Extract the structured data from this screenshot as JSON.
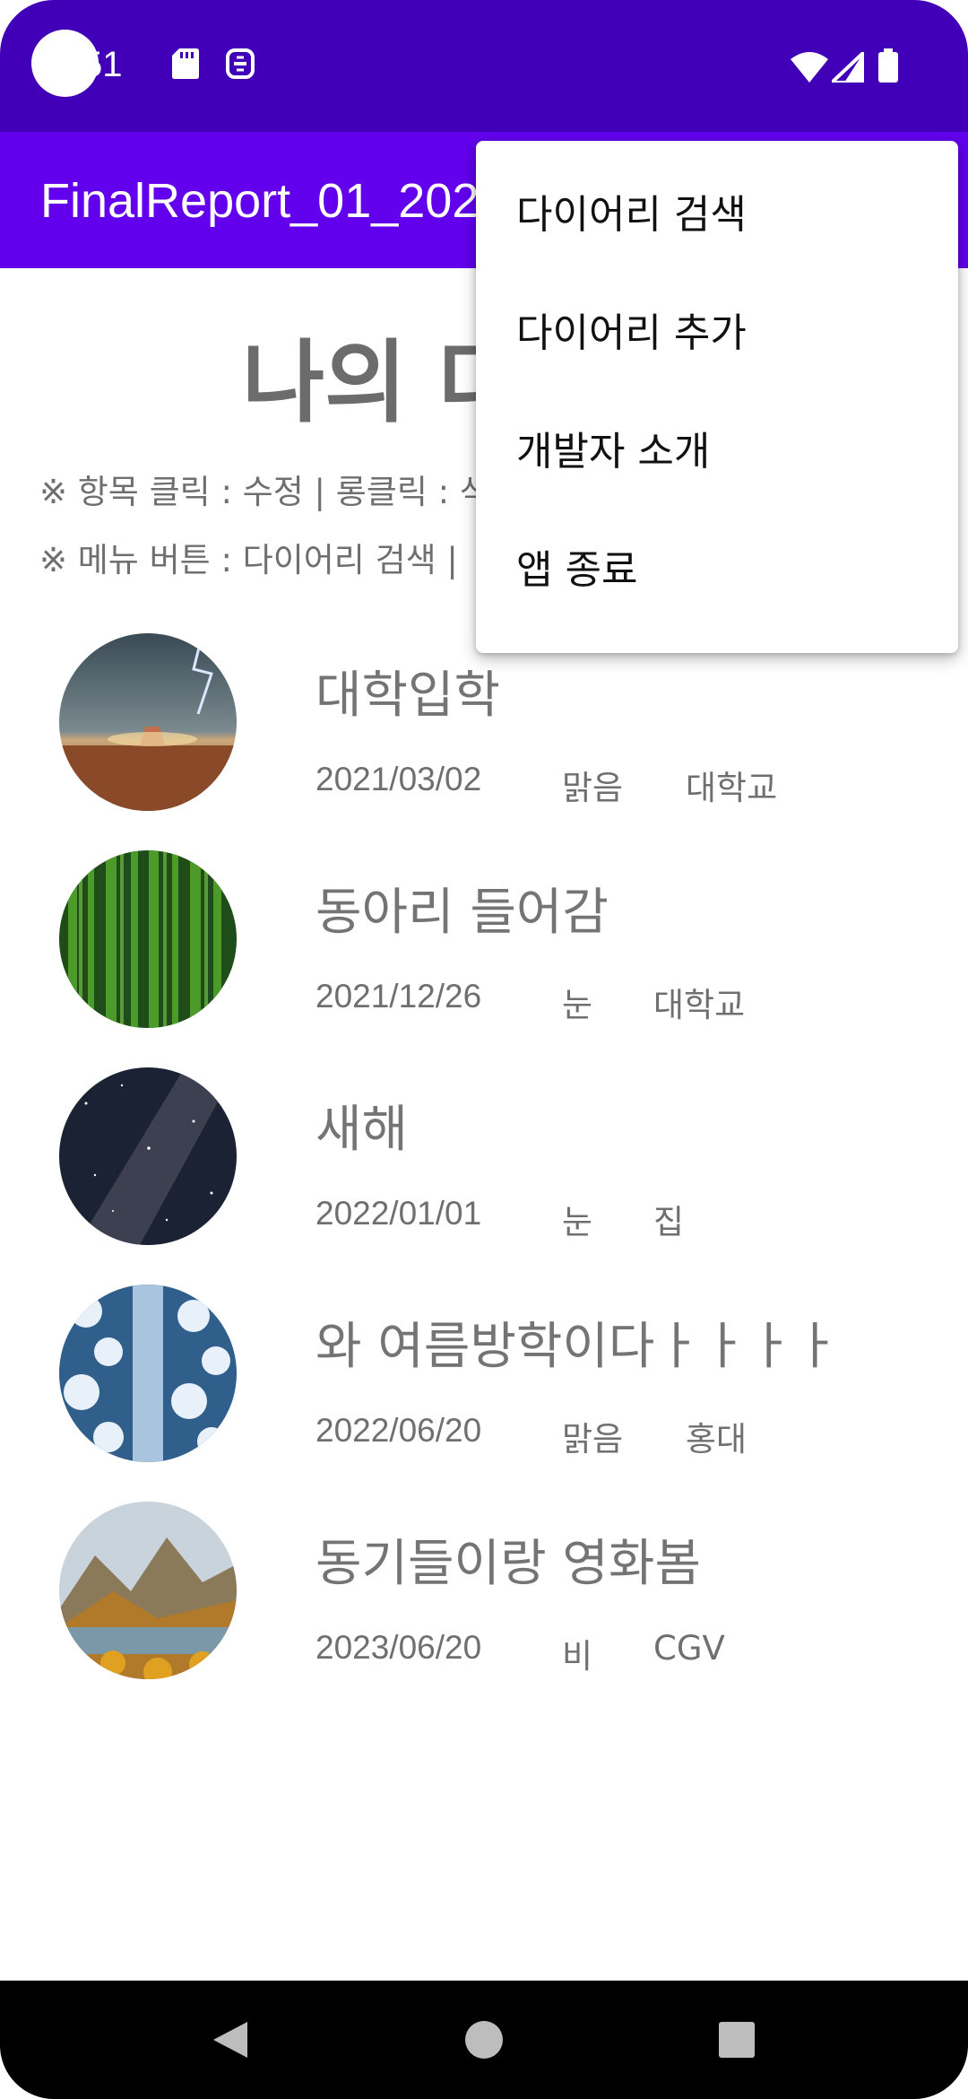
{
  "status_bar": {
    "time": "51",
    "bg_color": "#4100b8",
    "left_icons": [
      "sd-card-icon",
      "sync-icon"
    ],
    "right_icons": [
      "wifi-icon",
      "signal-icon",
      "battery-icon"
    ]
  },
  "app_bar": {
    "title": "FinalReport_01_202",
    "bg_color": "#6200ee"
  },
  "main": {
    "heading": "나의 다",
    "hint_line_1": "※ 항목 클릭 : 수정  |  롱클릭 : 삭",
    "hint_line_2": "※ 메뉴 버튼  :  다이어리 검색 |"
  },
  "diary_items": [
    {
      "title": "대학입학",
      "date": "2021/03/02",
      "weather": "맑음",
      "place": "대학교",
      "image": "desert-storm-photo"
    },
    {
      "title": "동아리 들어감",
      "date": "2021/12/26",
      "weather": "눈",
      "place": "대학교",
      "image": "forest-photo"
    },
    {
      "title": "새해",
      "date": "2022/01/01",
      "weather": "눈",
      "place": "집",
      "image": "night-sky-photo"
    },
    {
      "title": "와 여름방학이다ㅏㅏㅏㅏ",
      "date": "2022/06/20",
      "weather": "맑음",
      "place": "홍대",
      "image": "snowy-road-photo"
    },
    {
      "title": "동기들이랑 영화봄",
      "date": "2023/06/20",
      "weather": "비",
      "place": "CGV",
      "image": "mountain-lake-photo"
    }
  ],
  "overflow_menu": {
    "items": [
      "다이어리 검색",
      "다이어리 추가",
      "개발자 소개",
      "앱 종료"
    ]
  },
  "nav_bar": {
    "buttons": [
      "back-icon",
      "home-icon",
      "recents-icon"
    ]
  }
}
